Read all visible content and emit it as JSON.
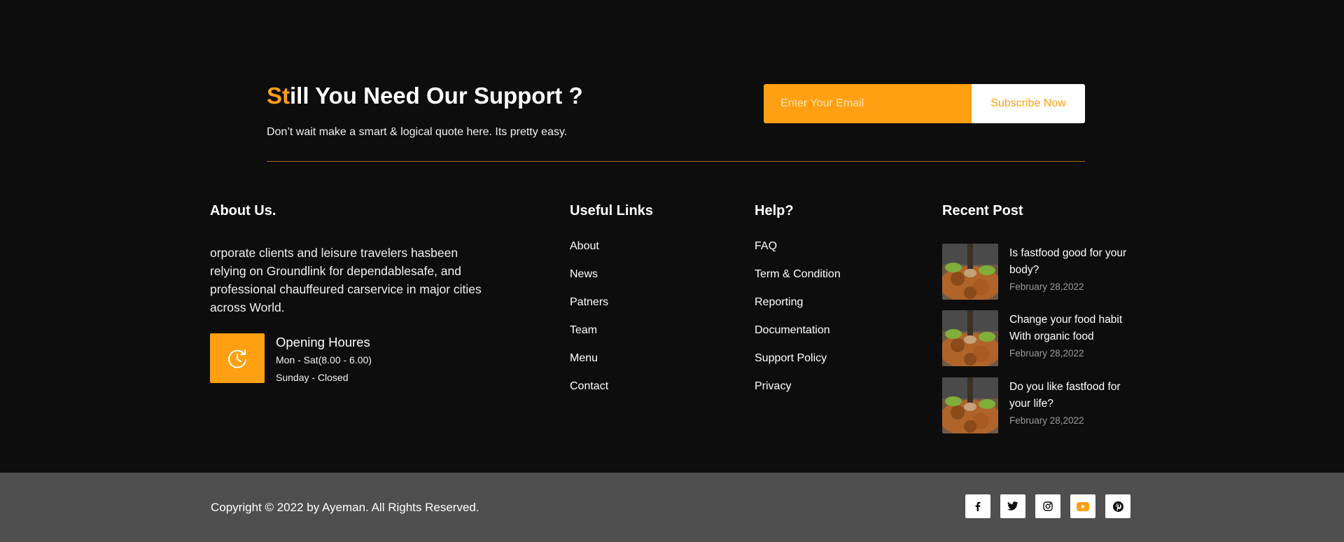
{
  "support": {
    "title_accent": "St",
    "title_rest": "ill You Need Our Support ?",
    "subtitle": "Don’t wait make a smart & logical quote here. Its pretty easy.",
    "email_placeholder": "Enter Your Email",
    "subscribe_label": "Subscribe Now"
  },
  "about": {
    "title": "About Us.",
    "text": "orporate clients and leisure travelers hasbeen relying on Groundlink for dependablesafe, and professional chauffeured carservice in major cities across World.",
    "hours_icon": "clock-icon",
    "hours_title": "Opening Houres",
    "hours_line1": "Mon - Sat(8.00 - 6.00)",
    "hours_line2": "Sunday - Closed"
  },
  "useful_links": {
    "title": "Useful Links",
    "items": [
      "About",
      "News",
      "Patners",
      "Team",
      "Menu",
      "Contact"
    ]
  },
  "help": {
    "title": "Help?",
    "items": [
      "FAQ",
      "Term & Condition",
      "Reporting",
      "Documentation",
      "Support Policy",
      "Privacy"
    ]
  },
  "recent_posts": {
    "title": "Recent Post",
    "posts": [
      {
        "title": "Is fastfood good for your body?",
        "date": "February 28,2022"
      },
      {
        "title": "Change your food habit With organic food",
        "date": "February 28,2022"
      },
      {
        "title": "Do you like fastfood for your life?",
        "date": "February 28,2022"
      }
    ]
  },
  "footer": {
    "copyright": "Copyright © 2022 by Ayeman. All Rights Reserved.",
    "social": [
      "facebook-icon",
      "twitter-icon",
      "instagram-icon",
      "youtube-icon",
      "pinterest-icon"
    ]
  },
  "colors": {
    "accent": "#ffa012",
    "background": "#0d0d0d",
    "bottom_bar": "#4f4f4f"
  }
}
